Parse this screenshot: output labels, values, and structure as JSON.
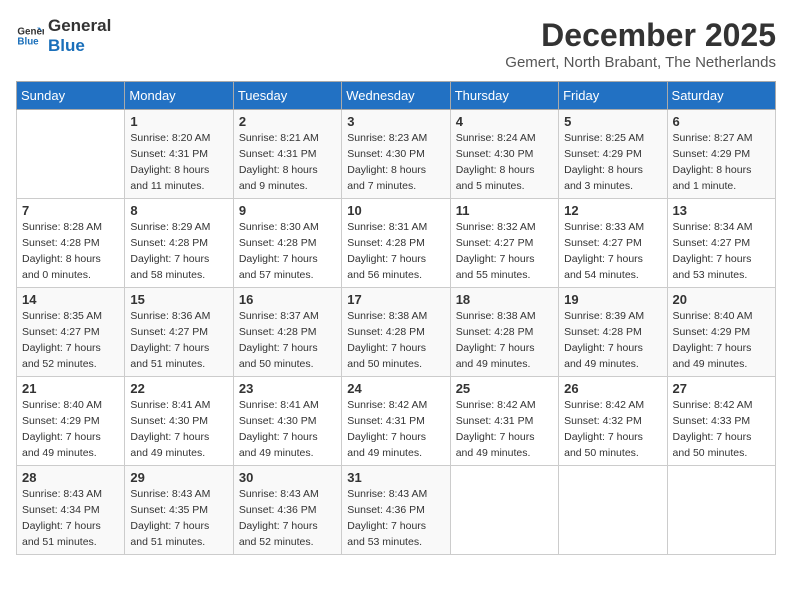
{
  "logo": {
    "line1": "General",
    "line2": "Blue"
  },
  "title": "December 2025",
  "subtitle": "Gemert, North Brabant, The Netherlands",
  "days_of_week": [
    "Sunday",
    "Monday",
    "Tuesday",
    "Wednesday",
    "Thursday",
    "Friday",
    "Saturday"
  ],
  "weeks": [
    [
      {
        "day": "",
        "sunrise": "",
        "sunset": "",
        "daylight": ""
      },
      {
        "day": "1",
        "sunrise": "8:20 AM",
        "sunset": "4:31 PM",
        "daylight": "8 hours and 11 minutes."
      },
      {
        "day": "2",
        "sunrise": "8:21 AM",
        "sunset": "4:31 PM",
        "daylight": "8 hours and 9 minutes."
      },
      {
        "day": "3",
        "sunrise": "8:23 AM",
        "sunset": "4:30 PM",
        "daylight": "8 hours and 7 minutes."
      },
      {
        "day": "4",
        "sunrise": "8:24 AM",
        "sunset": "4:30 PM",
        "daylight": "8 hours and 5 minutes."
      },
      {
        "day": "5",
        "sunrise": "8:25 AM",
        "sunset": "4:29 PM",
        "daylight": "8 hours and 3 minutes."
      },
      {
        "day": "6",
        "sunrise": "8:27 AM",
        "sunset": "4:29 PM",
        "daylight": "8 hours and 1 minute."
      }
    ],
    [
      {
        "day": "7",
        "sunrise": "8:28 AM",
        "sunset": "4:28 PM",
        "daylight": "8 hours and 0 minutes."
      },
      {
        "day": "8",
        "sunrise": "8:29 AM",
        "sunset": "4:28 PM",
        "daylight": "7 hours and 58 minutes."
      },
      {
        "day": "9",
        "sunrise": "8:30 AM",
        "sunset": "4:28 PM",
        "daylight": "7 hours and 57 minutes."
      },
      {
        "day": "10",
        "sunrise": "8:31 AM",
        "sunset": "4:28 PM",
        "daylight": "7 hours and 56 minutes."
      },
      {
        "day": "11",
        "sunrise": "8:32 AM",
        "sunset": "4:27 PM",
        "daylight": "7 hours and 55 minutes."
      },
      {
        "day": "12",
        "sunrise": "8:33 AM",
        "sunset": "4:27 PM",
        "daylight": "7 hours and 54 minutes."
      },
      {
        "day": "13",
        "sunrise": "8:34 AM",
        "sunset": "4:27 PM",
        "daylight": "7 hours and 53 minutes."
      }
    ],
    [
      {
        "day": "14",
        "sunrise": "8:35 AM",
        "sunset": "4:27 PM",
        "daylight": "7 hours and 52 minutes."
      },
      {
        "day": "15",
        "sunrise": "8:36 AM",
        "sunset": "4:27 PM",
        "daylight": "7 hours and 51 minutes."
      },
      {
        "day": "16",
        "sunrise": "8:37 AM",
        "sunset": "4:28 PM",
        "daylight": "7 hours and 50 minutes."
      },
      {
        "day": "17",
        "sunrise": "8:38 AM",
        "sunset": "4:28 PM",
        "daylight": "7 hours and 50 minutes."
      },
      {
        "day": "18",
        "sunrise": "8:38 AM",
        "sunset": "4:28 PM",
        "daylight": "7 hours and 49 minutes."
      },
      {
        "day": "19",
        "sunrise": "8:39 AM",
        "sunset": "4:28 PM",
        "daylight": "7 hours and 49 minutes."
      },
      {
        "day": "20",
        "sunrise": "8:40 AM",
        "sunset": "4:29 PM",
        "daylight": "7 hours and 49 minutes."
      }
    ],
    [
      {
        "day": "21",
        "sunrise": "8:40 AM",
        "sunset": "4:29 PM",
        "daylight": "7 hours and 49 minutes."
      },
      {
        "day": "22",
        "sunrise": "8:41 AM",
        "sunset": "4:30 PM",
        "daylight": "7 hours and 49 minutes."
      },
      {
        "day": "23",
        "sunrise": "8:41 AM",
        "sunset": "4:30 PM",
        "daylight": "7 hours and 49 minutes."
      },
      {
        "day": "24",
        "sunrise": "8:42 AM",
        "sunset": "4:31 PM",
        "daylight": "7 hours and 49 minutes."
      },
      {
        "day": "25",
        "sunrise": "8:42 AM",
        "sunset": "4:31 PM",
        "daylight": "7 hours and 49 minutes."
      },
      {
        "day": "26",
        "sunrise": "8:42 AM",
        "sunset": "4:32 PM",
        "daylight": "7 hours and 50 minutes."
      },
      {
        "day": "27",
        "sunrise": "8:42 AM",
        "sunset": "4:33 PM",
        "daylight": "7 hours and 50 minutes."
      }
    ],
    [
      {
        "day": "28",
        "sunrise": "8:43 AM",
        "sunset": "4:34 PM",
        "daylight": "7 hours and 51 minutes."
      },
      {
        "day": "29",
        "sunrise": "8:43 AM",
        "sunset": "4:35 PM",
        "daylight": "7 hours and 51 minutes."
      },
      {
        "day": "30",
        "sunrise": "8:43 AM",
        "sunset": "4:36 PM",
        "daylight": "7 hours and 52 minutes."
      },
      {
        "day": "31",
        "sunrise": "8:43 AM",
        "sunset": "4:36 PM",
        "daylight": "7 hours and 53 minutes."
      },
      {
        "day": "",
        "sunrise": "",
        "sunset": "",
        "daylight": ""
      },
      {
        "day": "",
        "sunrise": "",
        "sunset": "",
        "daylight": ""
      },
      {
        "day": "",
        "sunrise": "",
        "sunset": "",
        "daylight": ""
      }
    ]
  ],
  "labels": {
    "sunrise": "Sunrise:",
    "sunset": "Sunset:",
    "daylight": "Daylight:"
  }
}
